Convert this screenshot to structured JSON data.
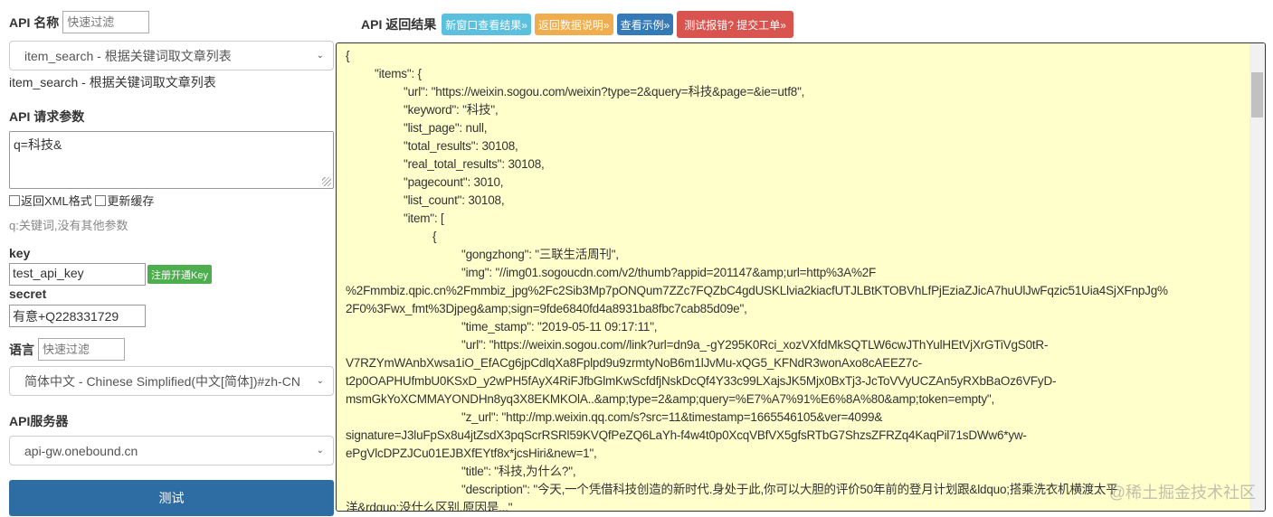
{
  "left": {
    "api_name_label": "API 名称",
    "filter_placeholder": "快速过滤",
    "api_select": "item_search - 根据关键词取文章列表",
    "api_desc": "item_search - 根据关键词取文章列表",
    "params_label": "API 请求参数",
    "params_value": "q=科技&",
    "xml_label": "返回XML格式",
    "cache_label": "更新缓存",
    "params_hint": "q:关键词,没有其他参数",
    "key_label": "key",
    "key_value": "test_api_key",
    "register_button": "注册开通Key",
    "secret_label": "secret",
    "secret_value": "有意+Q228331729",
    "lang_label": "语言",
    "lang_select": "简体中文 - Chinese Simplified(中文[简体])#zh-CN",
    "server_label": "API服务器",
    "server_select": "api-gw.onebound.cn",
    "test_button": "测试"
  },
  "top": {
    "title": "API 返回结果",
    "buttons": [
      {
        "label": "新窗口查看结果»",
        "color": "#5bc0de"
      },
      {
        "label": "返回数据说明»",
        "color": "#f0ad4e"
      },
      {
        "label": "查看示例»",
        "color": "#337ab7"
      },
      {
        "label": "测试报错? 提交工单»",
        "color": "#d9534f"
      }
    ]
  },
  "result_lines": [
    "{",
    "\t\"items\": {",
    "\t\t\"url\": \"https://weixin.sogou.com/weixin?type=2&query=科技&page=&ie=utf8\",",
    "\t\t\"keyword\": \"科技\",",
    "\t\t\"list_page\": null,",
    "\t\t\"total_results\": 30108,",
    "\t\t\"real_total_results\": 30108,",
    "\t\t\"pagecount\": 3010,",
    "\t\t\"list_count\": 30108,",
    "\t\t\"item\": [",
    "\t\t\t{",
    "\t\t\t\t\"gongzhong\": \"三联生活周刊\",",
    "\t\t\t\t\"img\": \"//img01.sogoucdn.com/v2/thumb?appid=201147&amp;url=http%3A%2F",
    "%2Fmmbiz.qpic.cn%2Fmmbiz_jpg%2Fc2Sib3Mp7pONQum7ZZc7FQZbC4gdUSKLlvia2kiacfUTJLBtKTOBVhLfPjEziaZJicA7huUlJwFqzic51Uia4SjXFnpJg%",
    "2F0%3Fwx_fmt%3Djpeg&amp;sign=9fde6840fd4a8931ba8fbc7cab85d09e\",",
    "\t\t\t\t\"time_stamp\": \"2019-05-11 09:17:11\",",
    "\t\t\t\t\"url\": \"https://weixin.sogou.com//link?url=dn9a_-gY295K0Rci_xozVXfdMkSQTLW6cwJThYulHEtVjXrGTiVgS0tR-",
    "V7RZYmWAnbXwsa1iO_EfACg6jpCdlqXa8Fplpd9u9zrmtyNoB6m1lJvMu-xQG5_KFNdR3wonAxo8cAEEZ7c-",
    "t2p0OAPHUfmbU0KSxD_y2wPH5fAyX4RiFJfbGlmKwScfdfjNskDcQf4Y33c99LXajsJK5Mjx0BxTj3-JcToVVyUCZAn5yRXbBaOz6VFyD-",
    "msmGkYoXCMMAYONDHn8yq3X8EKMKOlA..&amp;type=2&amp;query=%E7%A7%91%E6%8A%80&amp;token=empty\",",
    "\t\t\t\t\"z_url\": \"http://mp.weixin.qq.com/s?src=11&timestamp=1665546105&ver=4099&",
    "signature=J3luFpSx8u4jtZsdX3pqScrRSRl59KVQfPeZQ6LaYh-f4w4t0p0XcqVBfVX5gfsRTbG7ShzsZFRZq4KaqPil71sDWw6*yw-",
    "ePgVlcDPZJCu01EJBXfEYtf8x*jcsHiri&new=1\",",
    "\t\t\t\t\"title\": \"科技,为什么?\",",
    "\t\t\t\t\"description\": \"今天,一个凭借科技创造的新时代.身处于此,你可以大胆的评价50年前的登月计划跟&ldquo;搭乘洗衣机横渡太平",
    "洋&rdquo;没什么区别.原因是...\""
  ],
  "watermark": "@稀土掘金技术社区"
}
